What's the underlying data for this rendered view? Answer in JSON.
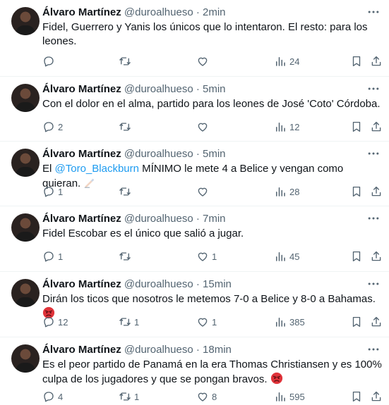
{
  "tweets": [
    {
      "name": "Álvaro Martínez",
      "handle": "@duroalhueso",
      "sep": "·",
      "time": "2min",
      "text": "Fidel, Guerrero y Yanis los únicos que lo intentaron. El resto: para los leones.",
      "replies": "",
      "retweets": "",
      "likes": "",
      "views": "24"
    },
    {
      "name": "Álvaro Martínez",
      "handle": "@duroalhueso",
      "sep": "·",
      "time": "5min",
      "text": "Con el dolor en el alma, partido para los leones de José 'Coto' Córdoba.",
      "replies": "2",
      "retweets": "",
      "likes": "",
      "views": "12"
    },
    {
      "name": "Álvaro Martínez",
      "handle": "@duroalhueso",
      "sep": "·",
      "time": "5min",
      "text_before": "El ",
      "mention": "@Toro_Blackburn",
      "text_after": " MÍNIMO le mete 4 a Belice y vengan como quieran.",
      "replies": "1",
      "retweets": "",
      "likes": "",
      "views": "28"
    },
    {
      "name": "Álvaro Martínez",
      "handle": "@duroalhueso",
      "sep": "·",
      "time": "7min",
      "text": "Fidel Escobar es el único que salió a jugar.",
      "replies": "1",
      "retweets": "",
      "likes": "1",
      "views": "45"
    },
    {
      "name": "Álvaro Martínez",
      "handle": "@duroalhueso",
      "sep": "·",
      "time": "15min",
      "text": "Dirán los ticos que nosotros le metemos 7-0 a Belice y 8-0 a Bahamas.",
      "replies": "12",
      "retweets": "1",
      "likes": "1",
      "views": "385"
    },
    {
      "name": "Álvaro Martínez",
      "handle": "@duroalhueso",
      "sep": "·",
      "time": "18min",
      "text": "Es el peor partido de Panamá en la era Thomas Christiansen y es 100% culpa de los jugadores y que se pongan bravos.",
      "replies": "4",
      "retweets": "1",
      "likes": "8",
      "views": "595"
    }
  ],
  "colors": {
    "text": "#0f1419",
    "muted": "#536471",
    "link": "#1d9bf0",
    "divider": "#eff3f4"
  },
  "icons": [
    "more-icon",
    "reply-icon",
    "retweet-icon",
    "like-icon",
    "views-icon",
    "bookmark-icon",
    "share-icon",
    "writing-hand-emoji",
    "angry-face-emoji"
  ]
}
